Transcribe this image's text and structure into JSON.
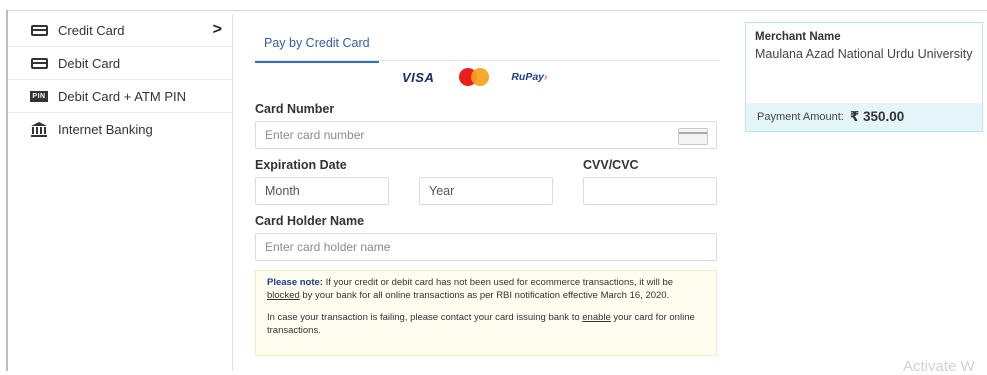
{
  "sidebar": {
    "items": [
      {
        "label": "Credit Card",
        "icon": "credit-card-icon",
        "active": true
      },
      {
        "label": "Debit Card",
        "icon": "debit-card-icon"
      },
      {
        "label": "Debit Card + ATM PIN",
        "icon": "pin-icon",
        "icon_text": "PIN"
      },
      {
        "label": "Internet Banking",
        "icon": "bank-icon"
      }
    ],
    "active_indicator": ">"
  },
  "main": {
    "tab_label": "Pay by Credit Card",
    "logos": {
      "visa": "VISA",
      "rupay_main": "RuPay",
      "rupay_suffix": "›"
    },
    "card_number": {
      "label": "Card Number",
      "placeholder": "Enter card number"
    },
    "expiration": {
      "label": "Expiration Date",
      "month": "Month",
      "year": "Year"
    },
    "cvv": {
      "label": "CVV/CVC"
    },
    "holder": {
      "label": "Card Holder Name",
      "placeholder": "Enter card holder name"
    },
    "note": {
      "title": "Please note:",
      "p1_a": " If your credit or debit card has not been used for ecommerce transactions, it will be ",
      "p1_link": "blocked",
      "p1_b": " by your bank for all online transactions as per RBI notification effective March 16, 2020.",
      "p2_a": "In case your transaction is failing, please contact your card issuing bank to ",
      "p2_link": "enable",
      "p2_b": " your card for online transactions."
    }
  },
  "merchant": {
    "label": "Merchant Name",
    "name": "Maulana Azad National Urdu University",
    "amount_label": "Payment Amount:",
    "amount": "₹ 350.00"
  },
  "watermark": "Activate W",
  "colors": {
    "accent": "#2e6fbf",
    "note_title": "#1a3d8f",
    "merchant_bottom": "#e5f6fb",
    "mc_red": "#e8201b",
    "mc_orange": "#f7a11a"
  }
}
